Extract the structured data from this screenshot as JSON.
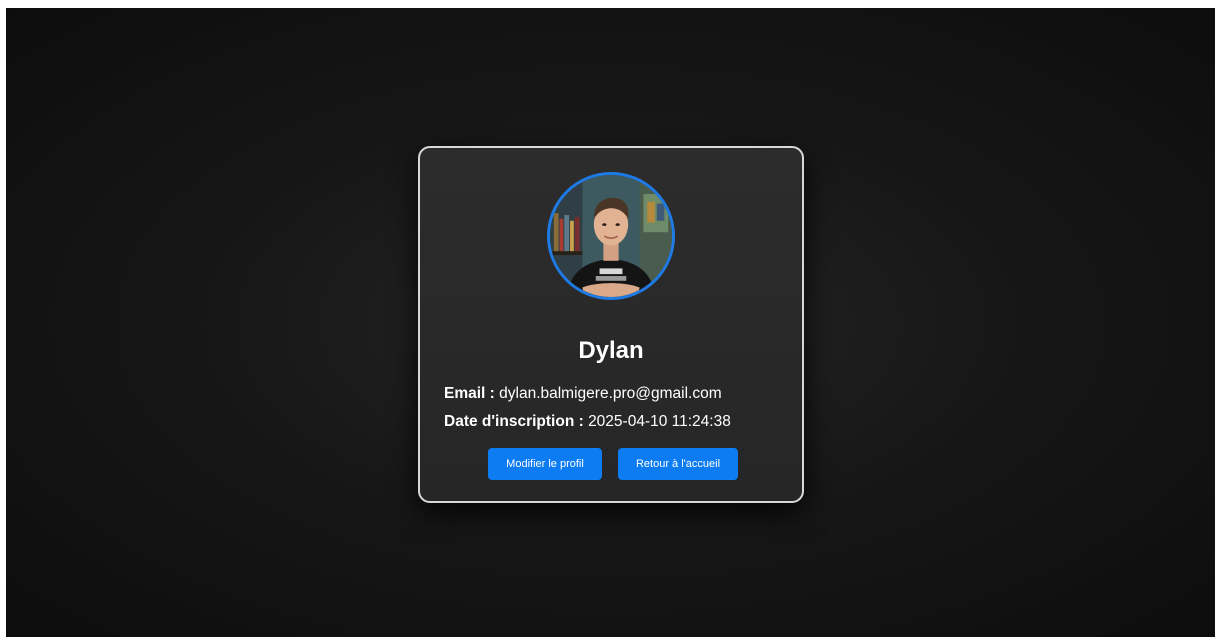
{
  "profile": {
    "name": "Dylan",
    "email_label": "Email :",
    "email_value": "dylan.balmigere.pro@gmail.com",
    "date_label": "Date d'inscription :",
    "date_value": "2025-04-10 11:24:38"
  },
  "actions": {
    "edit_label": "Modifier le profil",
    "home_label": "Retour à l'accueil"
  },
  "colors": {
    "accent": "#0d7cf2",
    "avatar_border": "#1e7be6",
    "card_border": "#d8d8d8",
    "card_bg": "#2a2a2a",
    "page_bg": "#161616"
  },
  "icons": {
    "avatar": "profile-photo"
  }
}
